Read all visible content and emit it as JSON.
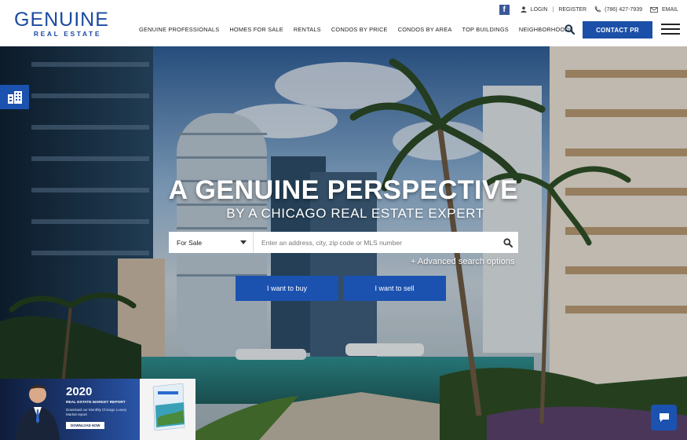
{
  "header": {
    "logo_main": "GENUINE",
    "logo_sub": "REAL ESTATE",
    "topbar": {
      "facebook_glyph": "f",
      "login": "LOGIN",
      "separator": "|",
      "register": "REGISTER",
      "phone": "(786) 427-7939",
      "email": "EMAIL"
    },
    "nav": [
      "GENUINE PROFESSIONALS",
      "HOMES FOR SALE",
      "RENTALS",
      "CONDOS BY PRICE",
      "CONDOS BY AREA",
      "TOP BUILDINGS",
      "NEIGHBORHOODS"
    ],
    "contact_label": "CONTACT PR"
  },
  "hero": {
    "headline": "A GENUINE PERSPECTIVE",
    "subline": "BY A CHICAGO REAL ESTATE EXPERT",
    "search": {
      "select_value": "For Sale",
      "placeholder": "Enter an address, city, zip code or MLS number"
    },
    "advanced_link": "+ Advanced search options",
    "buy_label": "I want to buy",
    "sell_label": "I want to sell"
  },
  "promo": {
    "year": "2020",
    "title": "REAL ESTATE MARKET REPORT",
    "text": "Download our Monthly Chicago Luxury Market report",
    "button": "DOWNLOAD NOW"
  },
  "colors": {
    "brand_blue": "#1b52b0",
    "logo_blue": "#1b4aa0",
    "facebook": "#3b5998"
  },
  "icons": {
    "facebook": "facebook-icon",
    "user": "user-icon",
    "phone": "phone-icon",
    "mail": "mail-icon",
    "search": "search-icon",
    "menu": "hamburger-menu-icon",
    "buildings": "buildings-icon",
    "chat": "chat-icon"
  }
}
